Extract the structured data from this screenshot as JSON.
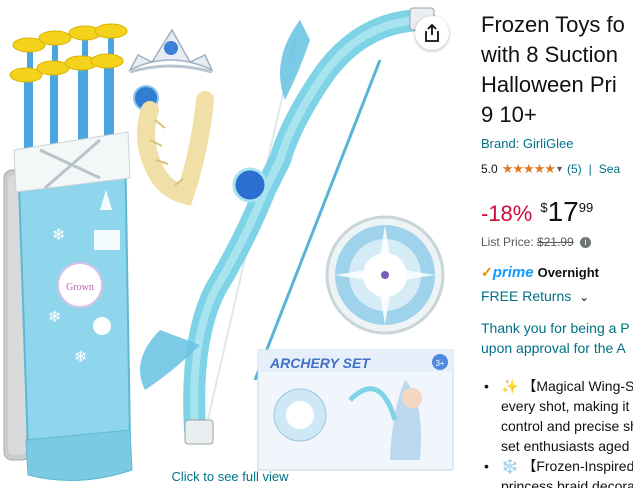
{
  "image_panel": {
    "see_full_view": "Click to see full view",
    "share_icon": "share-icon",
    "box_logo": "ARCHERY SET",
    "box_badge": "3+",
    "quiver_logo": "Grown"
  },
  "product": {
    "title_lines": [
      "Frozen Toys fo",
      "with 8 Suction",
      "Halloween Pri",
      "9 10+"
    ],
    "brand": "Brand: GirliGlee",
    "rating_value": "5.0",
    "stars": "★★★★★",
    "rating_count": "(5)",
    "separator": "|",
    "search_link": "Sea",
    "discount": "-18%",
    "price_symbol": "$",
    "price_whole": "17",
    "price_fraction": "99",
    "list_price_label": "List Price:",
    "list_price_value": "$21.99",
    "prime_label": "prime",
    "delivery": "Overnight",
    "returns": "FREE Returns",
    "promo_lines": [
      "Thank you for being a P",
      "upon approval for the A"
    ],
    "bullets": [
      {
        "icon": "✨",
        "lines": [
          "【Magical Wing-S",
          "every shot, making it",
          "control and precise sh",
          "set enthusiasts aged"
        ]
      },
      {
        "icon": "❄️",
        "lines": [
          "【Frozen-Inspired",
          "princess braid decora"
        ]
      }
    ]
  },
  "colors": {
    "link": "#007185",
    "discount": "#cc0c39",
    "star": "#de7921",
    "prime": "#1399ff",
    "bow": "#7fd3e6"
  }
}
